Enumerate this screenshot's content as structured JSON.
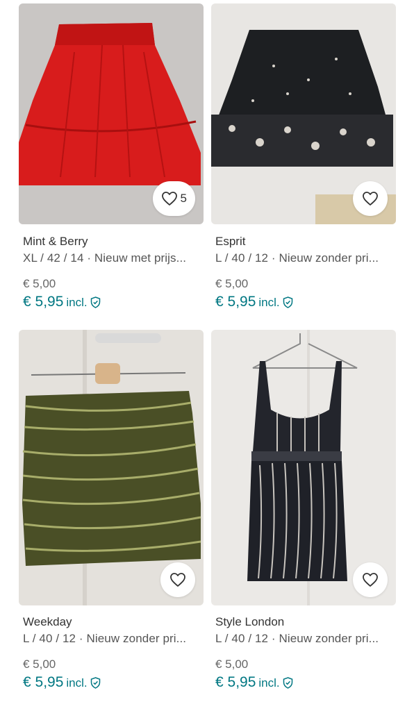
{
  "colors": {
    "accent": "#007782",
    "text": "#333333",
    "muted": "#666666"
  },
  "items": [
    {
      "brand": "Mint & Berry",
      "details": "XL / 42 / 14 · Nieuw met prijs...",
      "price": "€ 5,00",
      "price_incl": "€ 5,95",
      "incl_label": "incl.",
      "favorite_count": "5",
      "favorite_icon": "heart-icon",
      "protection_icon": "shield-check-icon"
    },
    {
      "brand": "Esprit",
      "details": "L / 40 / 12 · Nieuw zonder pri...",
      "price": "€ 5,00",
      "price_incl": "€ 5,95",
      "incl_label": "incl.",
      "favorite_icon": "heart-icon",
      "protection_icon": "shield-check-icon"
    },
    {
      "brand": "Weekday",
      "details": "L / 40 / 12 · Nieuw zonder pri...",
      "price": "€ 5,00",
      "price_incl": "€ 5,95",
      "incl_label": "incl.",
      "favorite_icon": "heart-icon",
      "protection_icon": "shield-check-icon"
    },
    {
      "brand": "Style London",
      "details": "L / 40 / 12 · Nieuw zonder pri...",
      "price": "€ 5,00",
      "price_incl": "€ 5,95",
      "incl_label": "incl.",
      "favorite_icon": "heart-icon",
      "protection_icon": "shield-check-icon"
    }
  ]
}
